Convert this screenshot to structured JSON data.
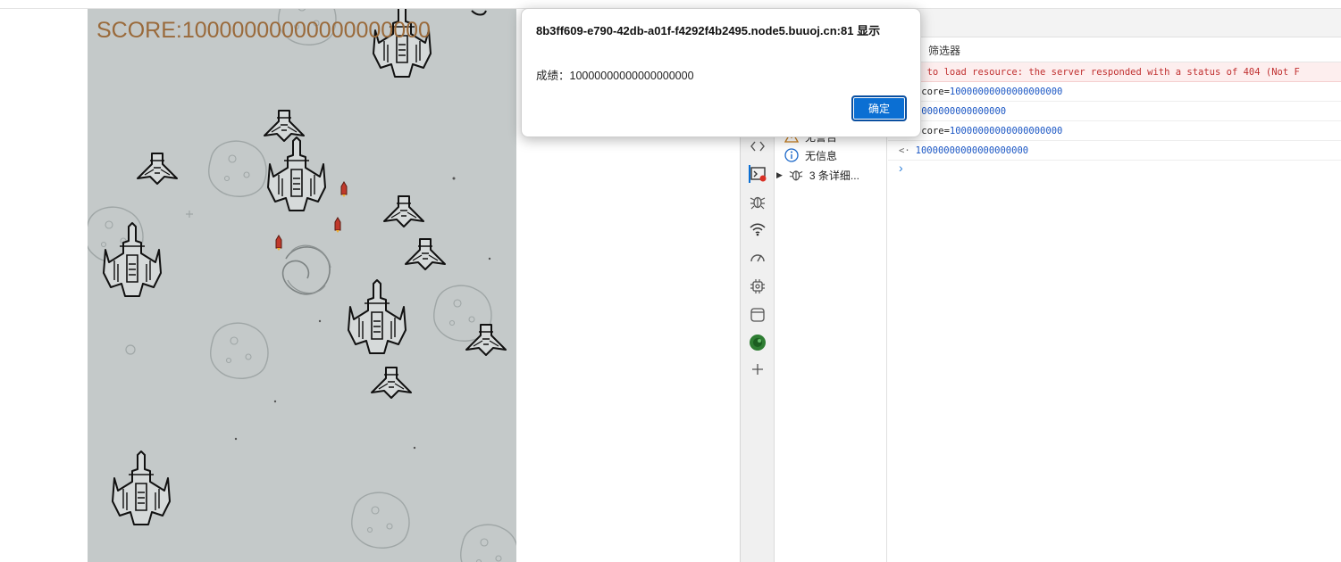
{
  "game": {
    "score_text": "SCORE:10000000000000000000"
  },
  "dialog": {
    "title": "8b3ff609-e790-42db-a01f-f4292f4b2495.node5.buuoj.cn:81 显示",
    "message": "成绩：10000000000000000000",
    "ok_label": "确定"
  },
  "devtools": {
    "filter_label": "筛选器",
    "sidebar": {
      "warnings_label": "无警告",
      "info_label": "无信息",
      "verbose_label": "3 条详细..."
    },
    "console_lines": [
      {
        "type": "error",
        "text": "iled to load resource: the server responded with a status of 404 (Not F"
      },
      {
        "type": "input",
        "key": "ameScore=",
        "value": "10000000000000000000"
      },
      {
        "type": "output",
        "value": "0000000000000000000"
      },
      {
        "type": "input",
        "key": "ameScore=",
        "value": "10000000000000000000"
      },
      {
        "type": "result",
        "arrow": "<·",
        "value": "10000000000000000000"
      }
    ],
    "prompt_symbol": "›"
  },
  "colors": {
    "game_bg": "#c4c9c9",
    "score_color": "#9a6a3b",
    "ok_button": "#0b6fd3",
    "error_bg": "#fdeeee",
    "value_blue": "#1a56c4"
  },
  "icons": [
    "elements-icon",
    "console-icon",
    "bug-icon",
    "network-icon",
    "performance-icon",
    "memory-chip-icon",
    "application-icon",
    "extension-icon",
    "add-icon",
    "warning-icon",
    "info-icon",
    "bug-verbose-icon"
  ]
}
